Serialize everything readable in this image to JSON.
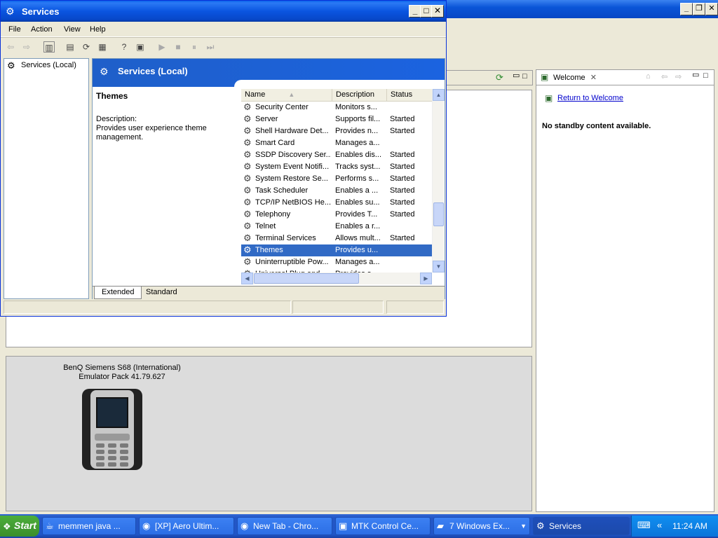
{
  "services_window": {
    "title": "Services",
    "menu": [
      "File",
      "Action",
      "View",
      "Help"
    ],
    "tree_root": "Services (Local)",
    "header_title": "Services (Local)",
    "selected_service": {
      "name": "Themes",
      "description_label": "Description:",
      "description_text": "Provides user experience theme management."
    },
    "columns": [
      "Name",
      "Description",
      "Status"
    ],
    "rows": [
      {
        "name": "Security Center",
        "description": "Monitors s...",
        "status": ""
      },
      {
        "name": "Server",
        "description": "Supports fil...",
        "status": "Started"
      },
      {
        "name": "Shell Hardware Det...",
        "description": "Provides n...",
        "status": "Started"
      },
      {
        "name": "Smart Card",
        "description": "Manages a...",
        "status": ""
      },
      {
        "name": "SSDP Discovery Ser...",
        "description": "Enables dis...",
        "status": "Started"
      },
      {
        "name": "System Event Notifi...",
        "description": "Tracks syst...",
        "status": "Started"
      },
      {
        "name": "System Restore Se...",
        "description": "Performs s...",
        "status": "Started"
      },
      {
        "name": "Task Scheduler",
        "description": "Enables a ...",
        "status": "Started"
      },
      {
        "name": "TCP/IP NetBIOS He...",
        "description": "Enables su...",
        "status": "Started"
      },
      {
        "name": "Telephony",
        "description": "Provides T...",
        "status": "Started"
      },
      {
        "name": "Telnet",
        "description": "Enables a r...",
        "status": ""
      },
      {
        "name": "Terminal Services",
        "description": "Allows mult...",
        "status": "Started"
      },
      {
        "name": "Themes",
        "description": "Provides u...",
        "status": "",
        "selected": true
      },
      {
        "name": "Uninterruptible Pow...",
        "description": "Manages a...",
        "status": ""
      },
      {
        "name": "Universal Plug and...",
        "description": "Provides s...",
        "status": ""
      }
    ],
    "tabs": [
      "Extended",
      "Standard"
    ]
  },
  "emulator": {
    "line1": "BenQ Siemens S68 (International)",
    "line2": "Emulator Pack 41.79.627"
  },
  "welcome": {
    "tab_label": "Welcome",
    "link": "Return to Welcome",
    "message": "No standby content available."
  },
  "taskbar": {
    "start_label": "Start",
    "items": [
      {
        "label": "memmen java ...",
        "icon": "java-icon"
      },
      {
        "label": "[XP] Aero Ultim...",
        "icon": "chrome-icon"
      },
      {
        "label": "New Tab - Chro...",
        "icon": "chrome-icon"
      },
      {
        "label": "MTK Control Ce...",
        "icon": "mtk-icon"
      },
      {
        "label": "7 Windows Ex...",
        "icon": "folder-icon"
      },
      {
        "label": "Services",
        "icon": "services-icon",
        "active": true
      }
    ],
    "clock": "11:24 AM"
  },
  "colors": {
    "title_blue": "#0a55d8",
    "selection_blue": "#316ac5",
    "taskbar_blue": "#2457c6",
    "start_green": "#3b8d2b"
  }
}
